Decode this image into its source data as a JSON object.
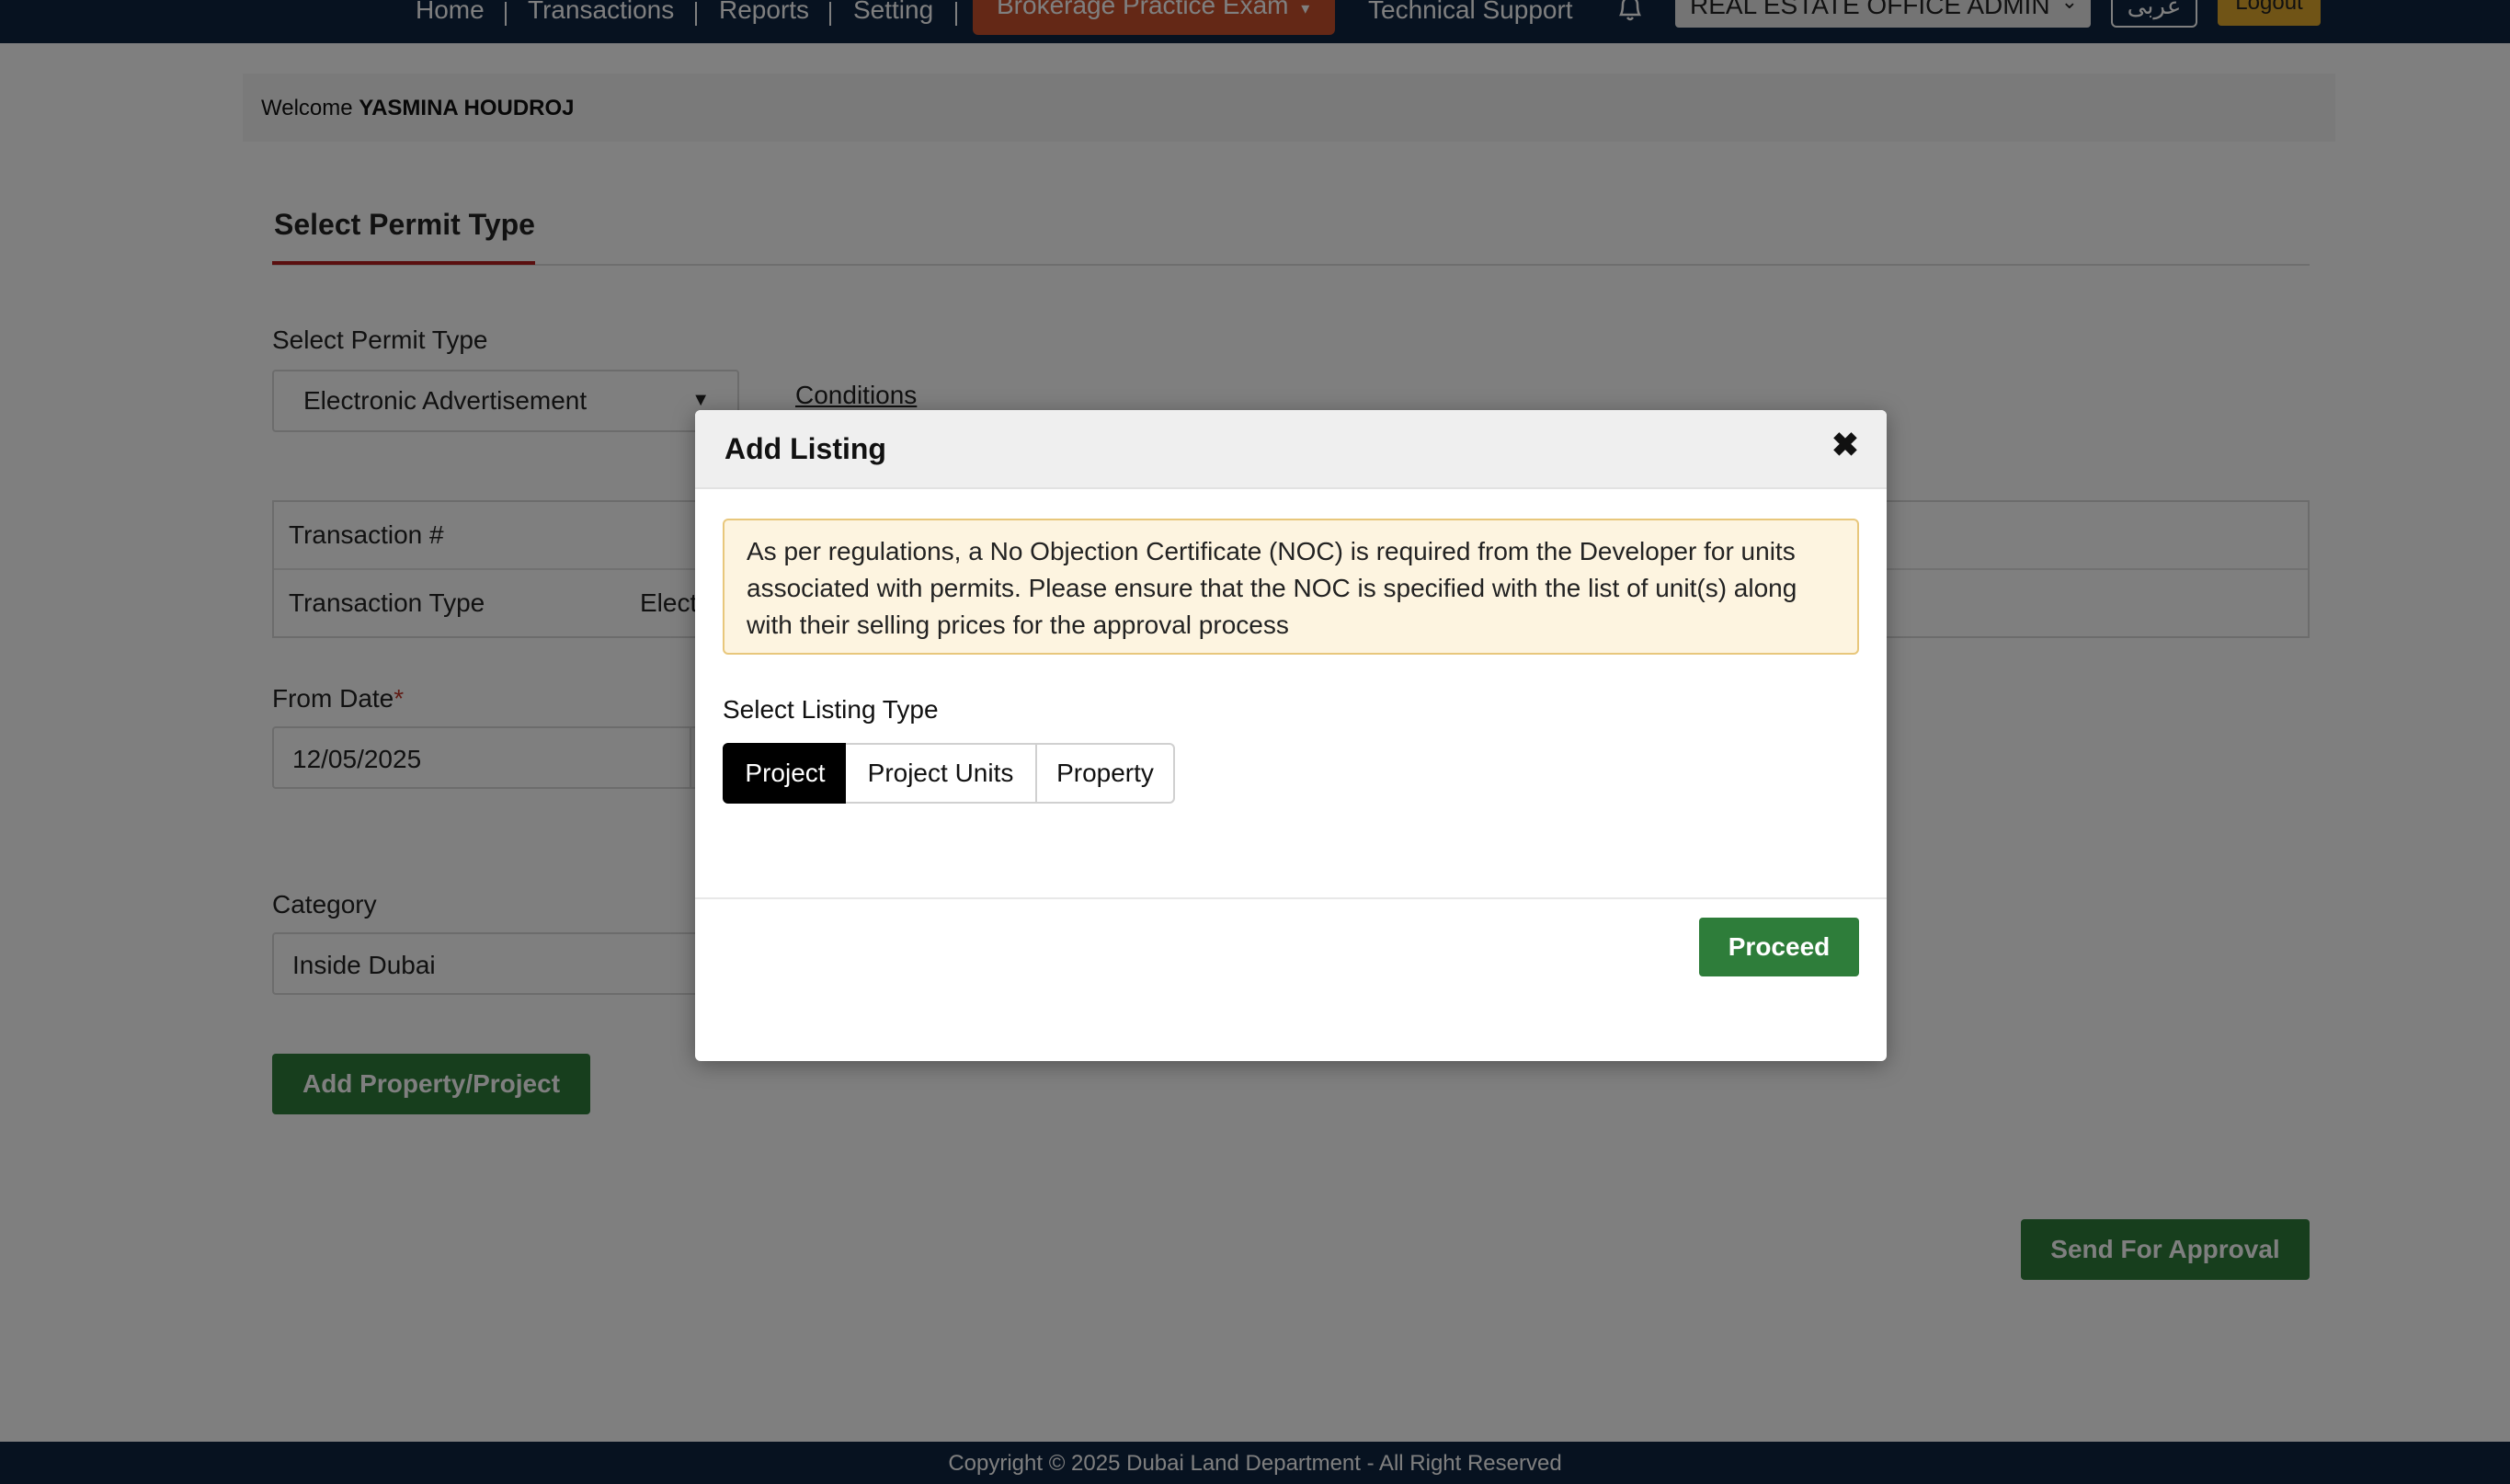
{
  "nav": {
    "items": [
      "Home",
      "Transactions",
      "Reports",
      "Setting"
    ],
    "exam_menu": "Brokerage Practice Exam",
    "support": "Technical Support",
    "role": "REAL ESTATE OFFICE ADMIN",
    "language": "عربى",
    "logout": "Logout"
  },
  "welcome": {
    "prefix": "Welcome",
    "name": "YASMINA HOUDROJ"
  },
  "form": {
    "tab_title": "Select Permit Type",
    "permit_type_label": "Select Permit Type",
    "permit_type_value": "Electronic Advertisement",
    "conditions_link": "Conditions",
    "transaction_no_label": "Transaction #",
    "transaction_type_label": "Transaction Type",
    "transaction_type_value": "Elect",
    "from_date_label": "From Date",
    "required_mark": "*",
    "from_date_value": "12/05/2025",
    "category_label": "Category",
    "category_value": "Inside Dubai",
    "add_property_button": "Add Property/Project",
    "send_approval_button": "Send For Approval"
  },
  "modal": {
    "title": "Add Listing",
    "close_glyph": "✖",
    "notice": "As per regulations, a No Objection Certificate (NOC) is required from the Developer for units associated with permits. Please ensure that the NOC is specified with the list of unit(s) along with their selling prices for the approval process",
    "listing_type_label": "Select Listing Type",
    "listing_types": [
      "Project",
      "Project Units",
      "Property"
    ],
    "selected_listing_type": "Project",
    "proceed_button": "Proceed"
  },
  "footer": {
    "copyright": "Copyright © 2025 Dubai Land Department - All Right Reserved"
  },
  "colors": {
    "nav_bg": "#0f2440",
    "exam_menu_bg": "#c8502d",
    "logout_bg": "#e0a92c",
    "accent_green": "#2e7d3a",
    "tab_underline": "#b41e1e",
    "notice_bg": "#fdf4e0"
  }
}
